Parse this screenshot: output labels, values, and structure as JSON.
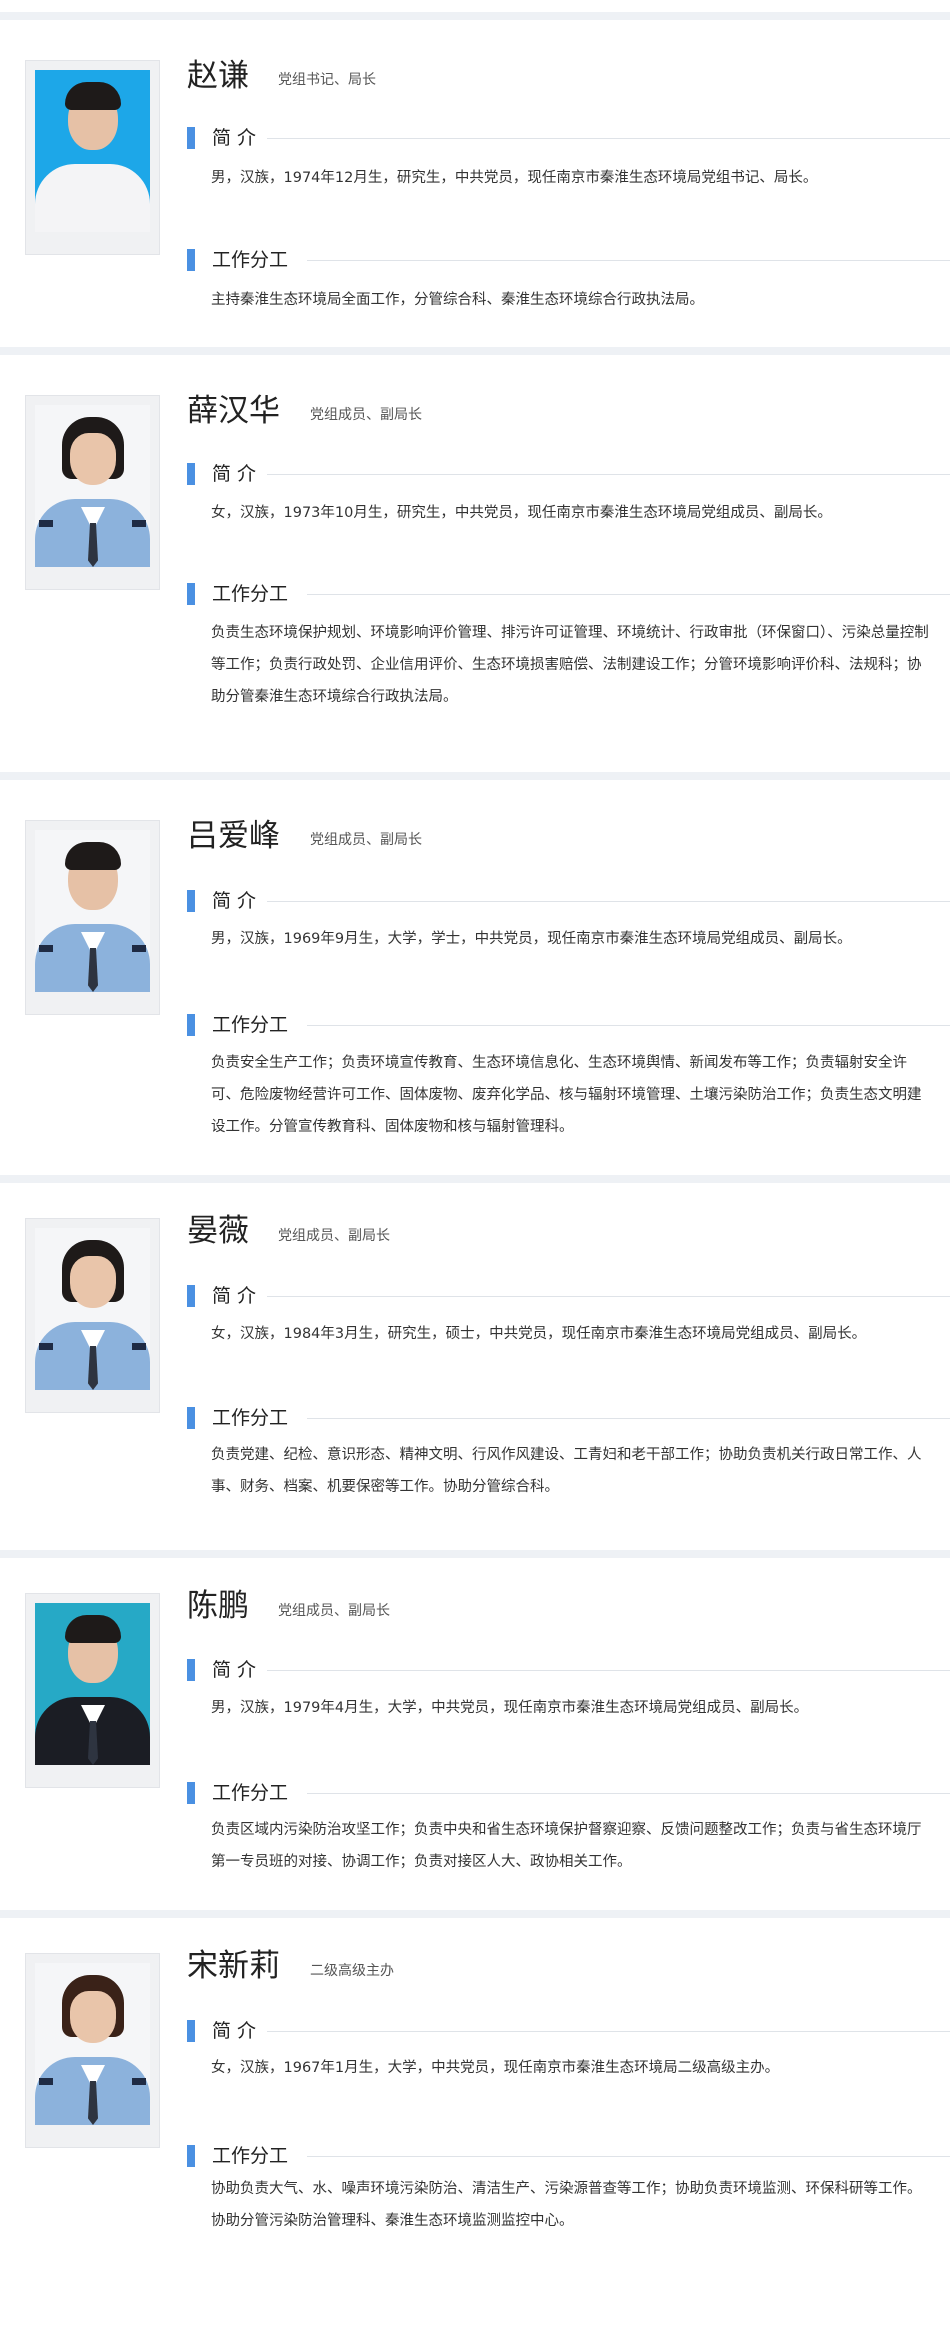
{
  "labels": {
    "intro": "简  介",
    "duty": "工作分工"
  },
  "leaders": [
    {
      "name": "赵谦",
      "title": "党组书记、局长",
      "intro": "男，汉族，1974年12月生，研究生，中共党员，现任南京市秦淮生态环境局党组书记、局长。",
      "duty": "主持秦淮生态环境局全面工作，分管综合科、秦淮生态环境综合行政执法局。"
    },
    {
      "name": "薛汉华",
      "title": "党组成员、副局长",
      "intro": "女，汉族，1973年10月生，研究生，中共党员，现任南京市秦淮生态环境局党组成员、副局长。",
      "duty": "负责生态环境保护规划、环境影响评价管理、排污许可证管理、环境统计、行政审批（环保窗口）、污染总量控制等工作；负责行政处罚、企业信用评价、生态环境损害赔偿、法制建设工作；分管环境影响评价科、法规科；协助分管秦淮生态环境综合行政执法局。"
    },
    {
      "name": "吕爱峰",
      "title": "党组成员、副局长",
      "intro": "男，汉族，1969年9月生，大学，学士，中共党员，现任南京市秦淮生态环境局党组成员、副局长。",
      "duty": "负责安全生产工作；负责环境宣传教育、生态环境信息化、生态环境舆情、新闻发布等工作；负责辐射安全许可、危险废物经营许可工作、固体废物、废弃化学品、核与辐射环境管理、土壤污染防治工作；负责生态文明建设工作。分管宣传教育科、固体废物和核与辐射管理科。"
    },
    {
      "name": "晏薇",
      "title": "党组成员、副局长",
      "intro": "女，汉族，1984年3月生，研究生，硕士，中共党员，现任南京市秦淮生态环境局党组成员、副局长。",
      "duty": "负责党建、纪检、意识形态、精神文明、行风作风建设、工青妇和老干部工作；协助负责机关行政日常工作、人事、财务、档案、机要保密等工作。协助分管综合科。"
    },
    {
      "name": "陈鹏",
      "title": "党组成员、副局长",
      "intro": "男，汉族，1979年4月生，大学，中共党员，现任南京市秦淮生态环境局党组成员、副局长。",
      "duty": "负责区域内污染防治攻坚工作；负责中央和省生态环境保护督察迎察、反馈问题整改工作；负责与省生态环境厅第一专员班的对接、协调工作；负责对接区人大、政协相关工作。"
    },
    {
      "name": "宋新莉",
      "title": "二级高级主办",
      "intro": "女，汉族，1967年1月生，大学，中共党员，现任南京市秦淮生态环境局二级高级主办。",
      "duty": "协助负责大气、水、噪声环境污染防治、清洁生产、污染源普查等工作；协助负责环境监测、环保科研等工作。协助分管污染防治管理科、秦淮生态环境监测监控中心。"
    }
  ]
}
